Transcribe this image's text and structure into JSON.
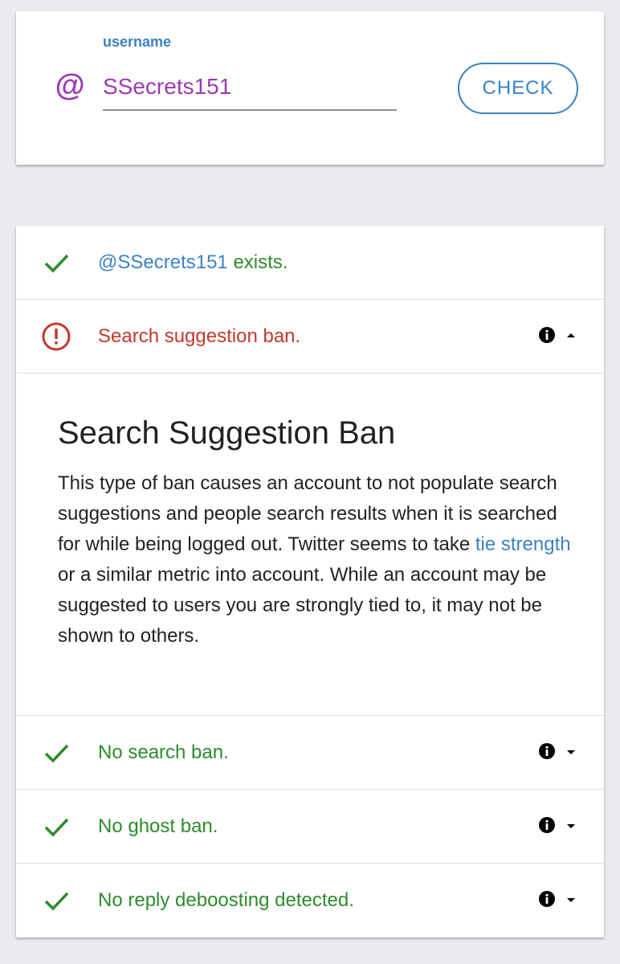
{
  "search": {
    "at_symbol": "@",
    "label": "username",
    "value": "SSecrets151",
    "check_label": "CHECK"
  },
  "results": [
    {
      "id": "exists",
      "status": "ok",
      "handle": "@SSecrets151",
      "text": " exists."
    },
    {
      "id": "search-suggestion-ban",
      "status": "ban",
      "text": "Search suggestion ban.",
      "expanded": true
    },
    {
      "id": "search-ban",
      "status": "ok",
      "text": "No search ban.",
      "expanded": false
    },
    {
      "id": "ghost-ban",
      "status": "ok",
      "text": "No ghost ban.",
      "expanded": false
    },
    {
      "id": "reply-deboosting",
      "status": "ok",
      "text": "No reply deboosting detected.",
      "expanded": false
    }
  ],
  "details": {
    "title": "Search Suggestion Ban",
    "body_1": "This type of ban causes an account to not populate search suggestions and people search results when it is searched for while being logged out. Twitter seems to take ",
    "link": "tie strength",
    "body_2": " or a similar metric into account. While an account may be suggested to users you are strongly tied to, it may not be shown to others."
  },
  "icons": {
    "ok": "check-icon",
    "ban": "alert-circle-icon",
    "info": "info-icon",
    "caret_up": "caret-up-icon",
    "caret_down": "caret-down-icon"
  },
  "colors": {
    "accent_blue": "#3b82c4",
    "at_purple": "#9b3cb0",
    "success_green": "#2e8b2e",
    "error_red": "#c0392b",
    "background": "#e9ebef"
  }
}
